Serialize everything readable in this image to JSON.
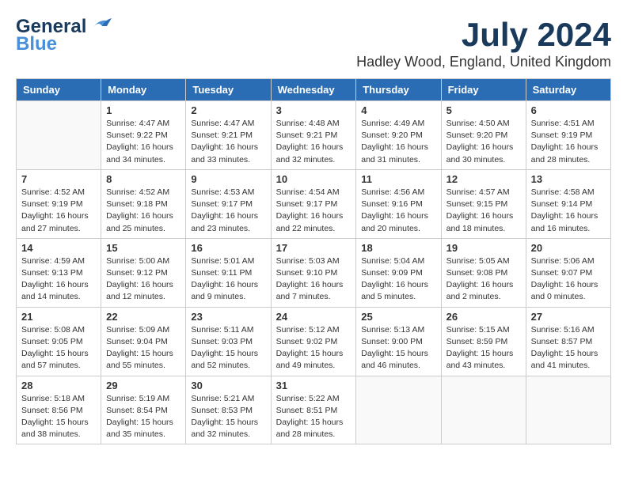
{
  "header": {
    "logo_general": "General",
    "logo_blue": "Blue",
    "month_year": "July 2024",
    "location": "Hadley Wood, England, United Kingdom"
  },
  "weekdays": [
    "Sunday",
    "Monday",
    "Tuesday",
    "Wednesday",
    "Thursday",
    "Friday",
    "Saturday"
  ],
  "weeks": [
    [
      {
        "day": "",
        "info": ""
      },
      {
        "day": "1",
        "info": "Sunrise: 4:47 AM\nSunset: 9:22 PM\nDaylight: 16 hours\nand 34 minutes."
      },
      {
        "day": "2",
        "info": "Sunrise: 4:47 AM\nSunset: 9:21 PM\nDaylight: 16 hours\nand 33 minutes."
      },
      {
        "day": "3",
        "info": "Sunrise: 4:48 AM\nSunset: 9:21 PM\nDaylight: 16 hours\nand 32 minutes."
      },
      {
        "day": "4",
        "info": "Sunrise: 4:49 AM\nSunset: 9:20 PM\nDaylight: 16 hours\nand 31 minutes."
      },
      {
        "day": "5",
        "info": "Sunrise: 4:50 AM\nSunset: 9:20 PM\nDaylight: 16 hours\nand 30 minutes."
      },
      {
        "day": "6",
        "info": "Sunrise: 4:51 AM\nSunset: 9:19 PM\nDaylight: 16 hours\nand 28 minutes."
      }
    ],
    [
      {
        "day": "7",
        "info": "Sunrise: 4:52 AM\nSunset: 9:19 PM\nDaylight: 16 hours\nand 27 minutes."
      },
      {
        "day": "8",
        "info": "Sunrise: 4:52 AM\nSunset: 9:18 PM\nDaylight: 16 hours\nand 25 minutes."
      },
      {
        "day": "9",
        "info": "Sunrise: 4:53 AM\nSunset: 9:17 PM\nDaylight: 16 hours\nand 23 minutes."
      },
      {
        "day": "10",
        "info": "Sunrise: 4:54 AM\nSunset: 9:17 PM\nDaylight: 16 hours\nand 22 minutes."
      },
      {
        "day": "11",
        "info": "Sunrise: 4:56 AM\nSunset: 9:16 PM\nDaylight: 16 hours\nand 20 minutes."
      },
      {
        "day": "12",
        "info": "Sunrise: 4:57 AM\nSunset: 9:15 PM\nDaylight: 16 hours\nand 18 minutes."
      },
      {
        "day": "13",
        "info": "Sunrise: 4:58 AM\nSunset: 9:14 PM\nDaylight: 16 hours\nand 16 minutes."
      }
    ],
    [
      {
        "day": "14",
        "info": "Sunrise: 4:59 AM\nSunset: 9:13 PM\nDaylight: 16 hours\nand 14 minutes."
      },
      {
        "day": "15",
        "info": "Sunrise: 5:00 AM\nSunset: 9:12 PM\nDaylight: 16 hours\nand 12 minutes."
      },
      {
        "day": "16",
        "info": "Sunrise: 5:01 AM\nSunset: 9:11 PM\nDaylight: 16 hours\nand 9 minutes."
      },
      {
        "day": "17",
        "info": "Sunrise: 5:03 AM\nSunset: 9:10 PM\nDaylight: 16 hours\nand 7 minutes."
      },
      {
        "day": "18",
        "info": "Sunrise: 5:04 AM\nSunset: 9:09 PM\nDaylight: 16 hours\nand 5 minutes."
      },
      {
        "day": "19",
        "info": "Sunrise: 5:05 AM\nSunset: 9:08 PM\nDaylight: 16 hours\nand 2 minutes."
      },
      {
        "day": "20",
        "info": "Sunrise: 5:06 AM\nSunset: 9:07 PM\nDaylight: 16 hours\nand 0 minutes."
      }
    ],
    [
      {
        "day": "21",
        "info": "Sunrise: 5:08 AM\nSunset: 9:05 PM\nDaylight: 15 hours\nand 57 minutes."
      },
      {
        "day": "22",
        "info": "Sunrise: 5:09 AM\nSunset: 9:04 PM\nDaylight: 15 hours\nand 55 minutes."
      },
      {
        "day": "23",
        "info": "Sunrise: 5:11 AM\nSunset: 9:03 PM\nDaylight: 15 hours\nand 52 minutes."
      },
      {
        "day": "24",
        "info": "Sunrise: 5:12 AM\nSunset: 9:02 PM\nDaylight: 15 hours\nand 49 minutes."
      },
      {
        "day": "25",
        "info": "Sunrise: 5:13 AM\nSunset: 9:00 PM\nDaylight: 15 hours\nand 46 minutes."
      },
      {
        "day": "26",
        "info": "Sunrise: 5:15 AM\nSunset: 8:59 PM\nDaylight: 15 hours\nand 43 minutes."
      },
      {
        "day": "27",
        "info": "Sunrise: 5:16 AM\nSunset: 8:57 PM\nDaylight: 15 hours\nand 41 minutes."
      }
    ],
    [
      {
        "day": "28",
        "info": "Sunrise: 5:18 AM\nSunset: 8:56 PM\nDaylight: 15 hours\nand 38 minutes."
      },
      {
        "day": "29",
        "info": "Sunrise: 5:19 AM\nSunset: 8:54 PM\nDaylight: 15 hours\nand 35 minutes."
      },
      {
        "day": "30",
        "info": "Sunrise: 5:21 AM\nSunset: 8:53 PM\nDaylight: 15 hours\nand 32 minutes."
      },
      {
        "day": "31",
        "info": "Sunrise: 5:22 AM\nSunset: 8:51 PM\nDaylight: 15 hours\nand 28 minutes."
      },
      {
        "day": "",
        "info": ""
      },
      {
        "day": "",
        "info": ""
      },
      {
        "day": "",
        "info": ""
      }
    ]
  ]
}
